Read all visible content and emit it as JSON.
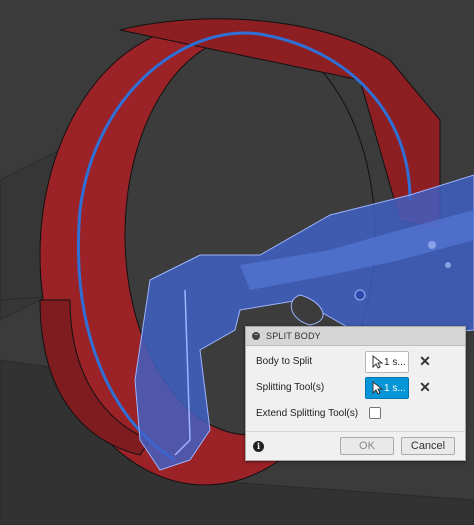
{
  "dialog": {
    "title": "SPLIT BODY",
    "rows": [
      {
        "label": "Body to Split",
        "selection": "1 s..."
      },
      {
        "label": "Splitting Tool(s)",
        "selection": "1 s..."
      },
      {
        "label": "Extend Splitting Tool(s)"
      }
    ],
    "ok_label": "OK",
    "cancel_label": "Cancel",
    "info_glyph": "i",
    "clear_glyph": "✕",
    "extend_checked": false
  },
  "colors": {
    "ring_fill": "#9b2226",
    "selection_blue": "#2f6fd6",
    "active_selection": "#0696d7",
    "background": "#3a3a3a"
  }
}
